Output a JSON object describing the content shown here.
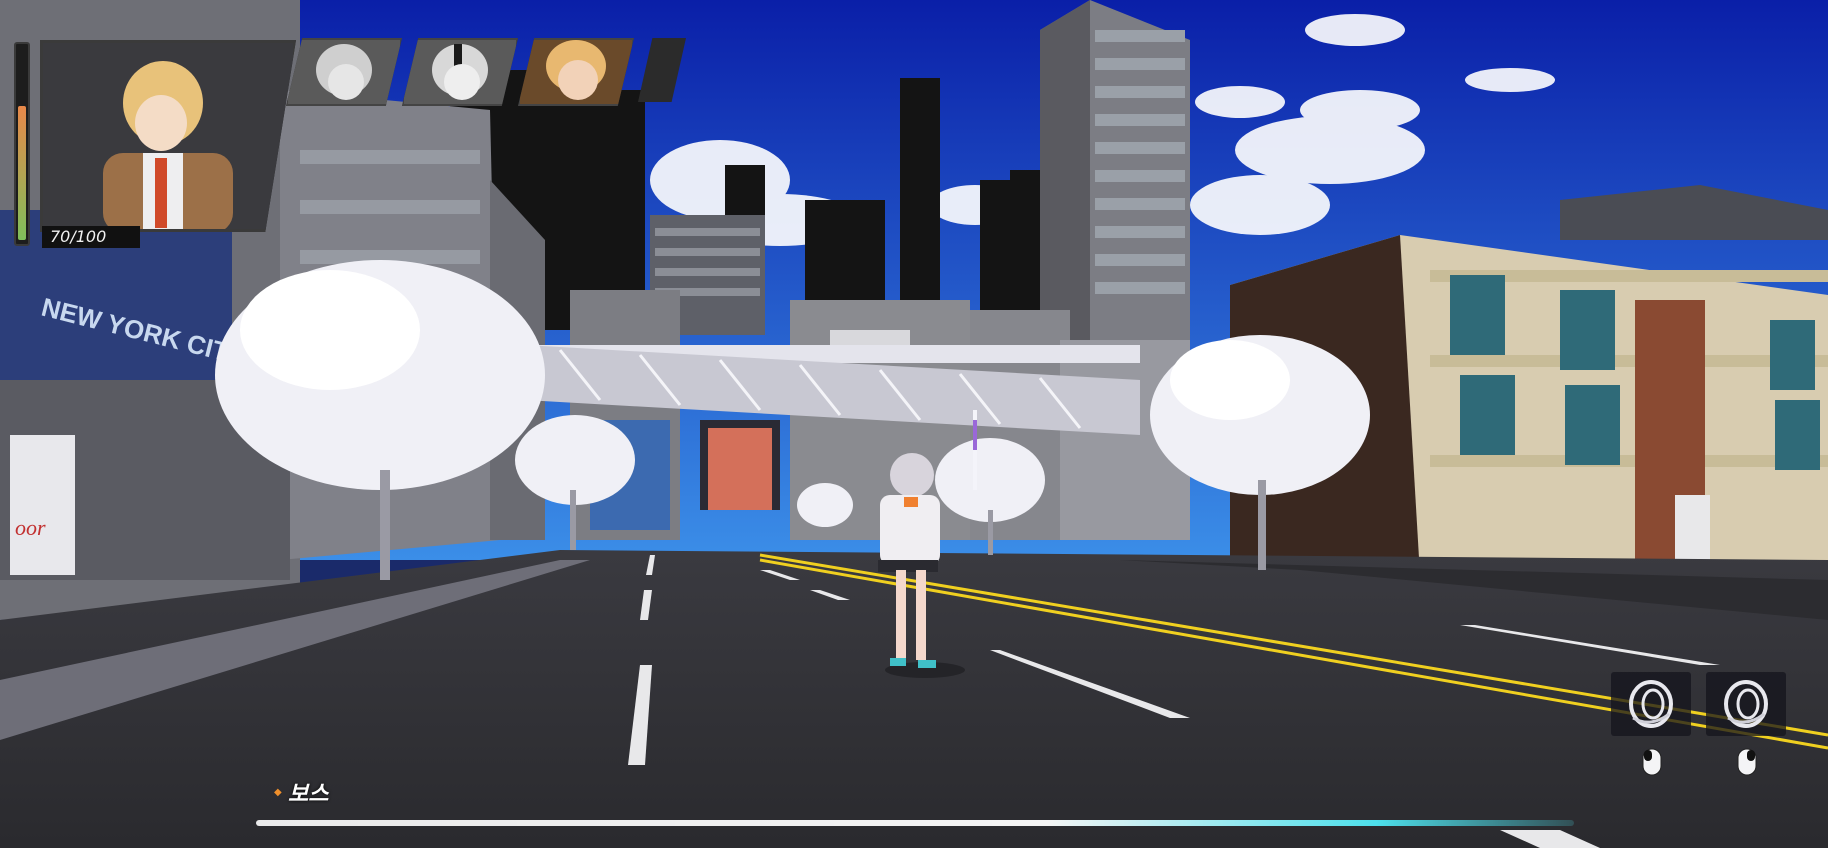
{
  "hud": {
    "active_character": {
      "hp_current": 70,
      "hp_max": 100,
      "hp_text": "70/100",
      "hp_fraction": 0.7,
      "gauge_colors": [
        "#e8884a",
        "#7fbf5a"
      ]
    },
    "party_slots": [
      {
        "state": "inactive-grayscale"
      },
      {
        "state": "inactive-grayscale"
      },
      {
        "state": "available-color"
      }
    ],
    "skills": [
      {
        "icon": "swirl-skill-icon",
        "input_icon": "mouse-left-icon"
      },
      {
        "icon": "swirl-skill-icon",
        "input_icon": "mouse-right-icon"
      }
    ],
    "boss": {
      "label": "보스",
      "hp_fraction": 0.96,
      "bar_color": "#4de0ec"
    }
  },
  "scene": {
    "billboard_text": "NEW YORK CITY",
    "wall_graffiti": "oor",
    "sky_color": "#1a3fc4"
  }
}
